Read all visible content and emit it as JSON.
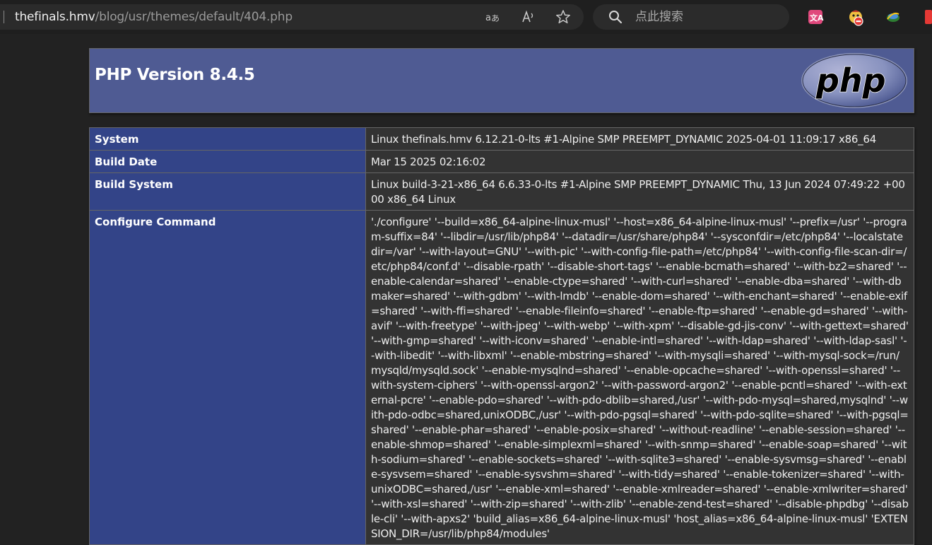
{
  "browser": {
    "url_host": "thefinals.hmv",
    "url_path": "/blog/usr/themes/default/404.php",
    "read_aloud_icon": "read-aloud-icon",
    "translate_icon": "translate-icon",
    "favorite_icon": "star-icon",
    "search_placeholder": "点此搜索",
    "extensions": [
      "translate-extension-icon",
      "mascot-extension-icon",
      "globe-extension-icon",
      "red-extension-icon"
    ]
  },
  "phpinfo": {
    "title": "PHP Version 8.4.5",
    "logo_text": "php",
    "rows": [
      {
        "key": "System",
        "value": "Linux thefinals.hmv 6.12.21-0-lts #1-Alpine SMP PREEMPT_DYNAMIC 2025-04-01 11:09:17 x86_64"
      },
      {
        "key": "Build Date",
        "value": "Mar 15 2025 02:16:02"
      },
      {
        "key": "Build System",
        "value": "Linux build-3-21-x86_64 6.6.33-0-lts #1-Alpine SMP PREEMPT_DYNAMIC Thu, 13 Jun 2024 07:49:22 +0000 x86_64 Linux"
      },
      {
        "key": "Configure Command",
        "value": "'./configure' '--build=x86_64-alpine-linux-musl' '--host=x86_64-alpine-linux-musl' '--prefix=/usr' '--program-suffix=84' '--libdir=/usr/lib/php84' '--datadir=/usr/share/php84' '--sysconfdir=/etc/php84' '--localstatedir=/var' '--with-layout=GNU' '--with-pic' '--with-config-file-path=/etc/php84' '--with-config-file-scan-dir=/etc/php84/conf.d' '--disable-rpath' '--disable-short-tags' '--enable-bcmath=shared' '--with-bz2=shared' '--enable-calendar=shared' '--enable-ctype=shared' '--with-curl=shared' '--enable-dba=shared' '--with-dbmaker=shared' '--with-gdbm' '--with-lmdb' '--enable-dom=shared' '--with-enchant=shared' '--enable-exif=shared' '--with-ffi=shared' '--enable-fileinfo=shared' '--enable-ftp=shared' '--enable-gd=shared' '--with-avif' '--with-freetype' '--with-jpeg' '--with-webp' '--with-xpm' '--disable-gd-jis-conv' '--with-gettext=shared' '--with-gmp=shared' '--with-iconv=shared' '--enable-intl=shared' '--with-ldap=shared' '--with-ldap-sasl' '--with-libedit' '--with-libxml' '--enable-mbstring=shared' '--with-mysqli=shared' '--with-mysql-sock=/run/mysqld/mysqld.sock' '--enable-mysqlnd=shared' '--enable-opcache=shared' '--with-openssl=shared' '--with-system-ciphers' '--with-openssl-argon2' '--with-password-argon2' '--enable-pcntl=shared' '--with-external-pcre' '--enable-pdo=shared' '--with-pdo-dblib=shared,/usr' '--with-pdo-mysql=shared,mysqlnd' '--with-pdo-odbc=shared,unixODBC,/usr' '--with-pdo-pgsql=shared' '--with-pdo-sqlite=shared' '--with-pgsql=shared' '--enable-phar=shared' '--enable-posix=shared' '--without-readline' '--enable-session=shared' '--enable-shmop=shared' '--enable-simplexml=shared' '--with-snmp=shared' '--enable-soap=shared' '--with-sodium=shared' '--enable-sockets=shared' '--with-sqlite3=shared' '--enable-sysvmsg=shared' '--enable-sysvsem=shared' '--enable-sysvshm=shared' '--with-tidy=shared' '--enable-tokenizer=shared' '--with-unixODBC=shared,/usr' '--enable-xml=shared' '--enable-xmlreader=shared' '--enable-xmlwriter=shared' '--with-xsl=shared' '--with-zip=shared' '--with-zlib' '--enable-zend-test=shared' '--disable-phpdbg' '--disable-cli' '--with-apxs2' 'build_alias=x86_64-alpine-linux-musl' 'host_alias=x86_64-alpine-linux-musl' 'EXTENSION_DIR=/usr/lib/php84/modules'"
      }
    ]
  },
  "colors": {
    "header_bg": "#4f5b93",
    "key_bg": "#334488",
    "value_bg": "#333333",
    "page_bg": "#222222"
  }
}
